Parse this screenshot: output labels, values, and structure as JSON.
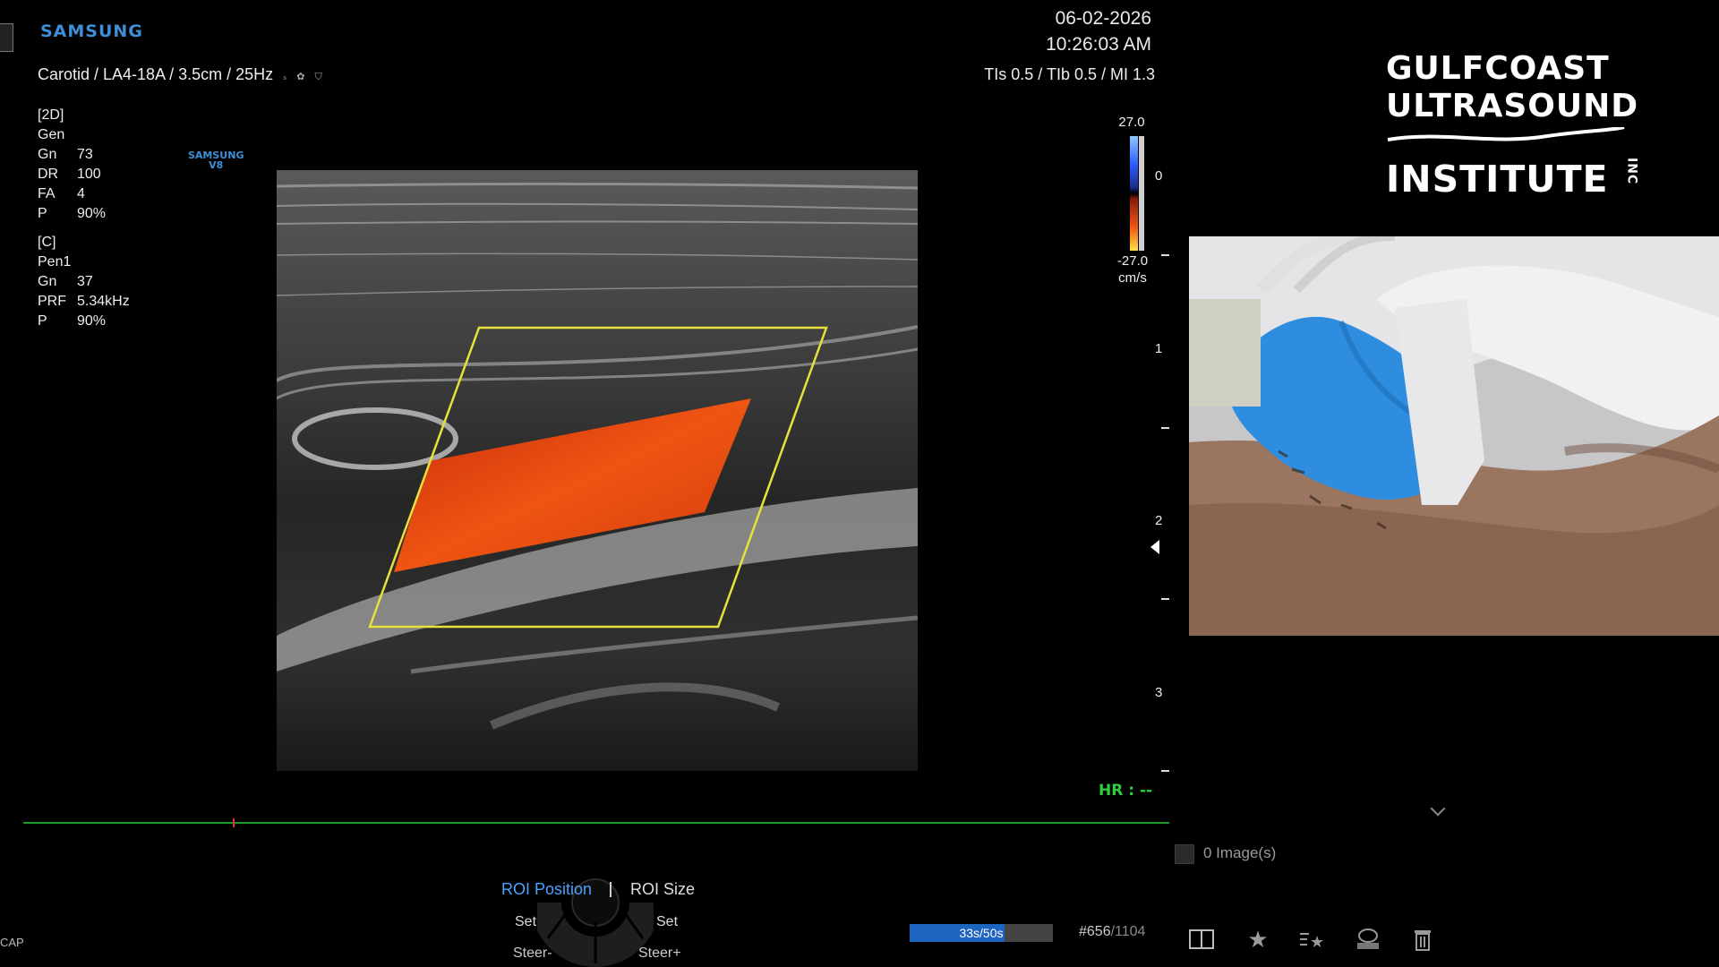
{
  "header": {
    "brand": "SAMSUNG",
    "date": "06-02-2026",
    "time": "10:26:03 AM",
    "preset": "Carotid / LA4-18A / 3.5cm / 25Hz",
    "preset_icons": [
      "s-har-icon",
      "color-mode-icon",
      "probe-icon"
    ],
    "safety": "TIs 0.5 / TIb 0.5 / MI 1.3"
  },
  "params_2d": {
    "title": "[2D]",
    "mode": "Gen",
    "rows": [
      {
        "k": "Gn",
        "v": "73"
      },
      {
        "k": "DR",
        "v": "100"
      },
      {
        "k": "FA",
        "v": "4"
      },
      {
        "k": "P",
        "v": "90%"
      }
    ]
  },
  "params_c": {
    "title": "[C]",
    "mode": "Pen1",
    "rows": [
      {
        "k": "Gn",
        "v": "37"
      },
      {
        "k": "PRF",
        "v": "5.34kHz"
      },
      {
        "k": "P",
        "v": "90%"
      }
    ]
  },
  "v8_logo": {
    "line1": "SAMSUNG",
    "line2": "V8"
  },
  "color_scale": {
    "top": "27.0",
    "bottom": "-27.0",
    "unit": "cm/s"
  },
  "depth_labels": [
    "0",
    "1",
    "2",
    "3"
  ],
  "heart_rate": "HR : --",
  "logo": {
    "line1": "GULFCOAST",
    "line2": "ULTRASOUND",
    "line3": "INSTITUTE",
    "inc": "INC"
  },
  "images": {
    "count_text": "0 Image(s)"
  },
  "controls": {
    "roi_position": "ROI Position",
    "roi_size": "ROI Size",
    "set_left": "Set",
    "set_right": "Set",
    "steer_left": "Steer-",
    "steer_right": "Steer+"
  },
  "cine": {
    "progress_text": "33s/50s",
    "progress_fraction": 0.66,
    "frame_current": "#656",
    "frame_total": "/1104"
  },
  "cap_label": "CAP",
  "toolbar": [
    "split-view-icon",
    "star-icon",
    "star-list-icon",
    "dicom-icon",
    "trash-icon"
  ],
  "colors": {
    "brand_blue": "#3e8fd6",
    "hr_green": "#2ecc40",
    "roi_yellow": "#e8e03c",
    "accent_blue": "#4aa3ff"
  }
}
